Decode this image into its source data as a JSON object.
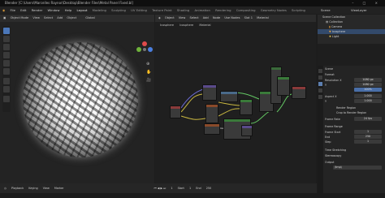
{
  "titlebar": {
    "title": "Blender [C:\\Users\\Marcelles Raynor\\Desktop\\Blender Files\\Metal Panel Fixed.bl]",
    "window_controls": "– □ ×"
  },
  "menubar": {
    "menus": [
      "File",
      "Edit",
      "Render",
      "Window",
      "Help"
    ],
    "workspaces": [
      "Layout",
      "Modeling",
      "Sculpting",
      "UV Editing",
      "Texture Paint",
      "Shading",
      "Animation",
      "Rendering",
      "Compositing",
      "Geometry Nodes",
      "Scripting"
    ],
    "active_workspace": "Layout",
    "scene_label": "Scene",
    "view_layer_label": "ViewLayer"
  },
  "viewport": {
    "mode": "Object Mode",
    "menus": [
      "View",
      "Select",
      "Add",
      "Object"
    ],
    "transform": "Global"
  },
  "node_editor": {
    "mode": "Object",
    "menus": [
      "View",
      "Select",
      "Add",
      "Node"
    ],
    "use_nodes": "Use Nodes",
    "slot": "Slot 1",
    "material": "Material",
    "breadcrumb": [
      "Icosphere",
      "Icosphere",
      "Material"
    ]
  },
  "outliner": {
    "title": "Scene Collection",
    "items": [
      "Collection",
      "Camera",
      "Icosphere",
      "Light"
    ]
  },
  "properties": {
    "section": "Scene",
    "format": {
      "label": "Format",
      "resolution_x_label": "Resolution X",
      "resolution_x": "1080 px",
      "resolution_y_label": "Y",
      "resolution_y": "1080 px",
      "percent": "100%",
      "aspect_x_label": "Aspect X",
      "aspect_x": "1.000",
      "aspect_y_label": "Y",
      "aspect_y": "1.000",
      "render_region": "Render Region",
      "crop": "Crop to Render Region",
      "frame_rate_label": "Frame Rate",
      "frame_rate": "24 fps"
    },
    "frame_range": {
      "label": "Frame Range",
      "start_label": "Frame Start",
      "start": "1",
      "end_label": "End",
      "end": "250",
      "step_label": "Step",
      "step": "1"
    },
    "time_stretching": "Time Stretching",
    "stereoscopy": "Stereoscopy",
    "output": "Output",
    "output_path": "/tmp\\"
  },
  "timeline": {
    "items": [
      "Playback",
      "Keying",
      "View",
      "Marker"
    ],
    "frame": "1",
    "start_label": "Start",
    "start": "1",
    "end_label": "End",
    "end": "250"
  }
}
